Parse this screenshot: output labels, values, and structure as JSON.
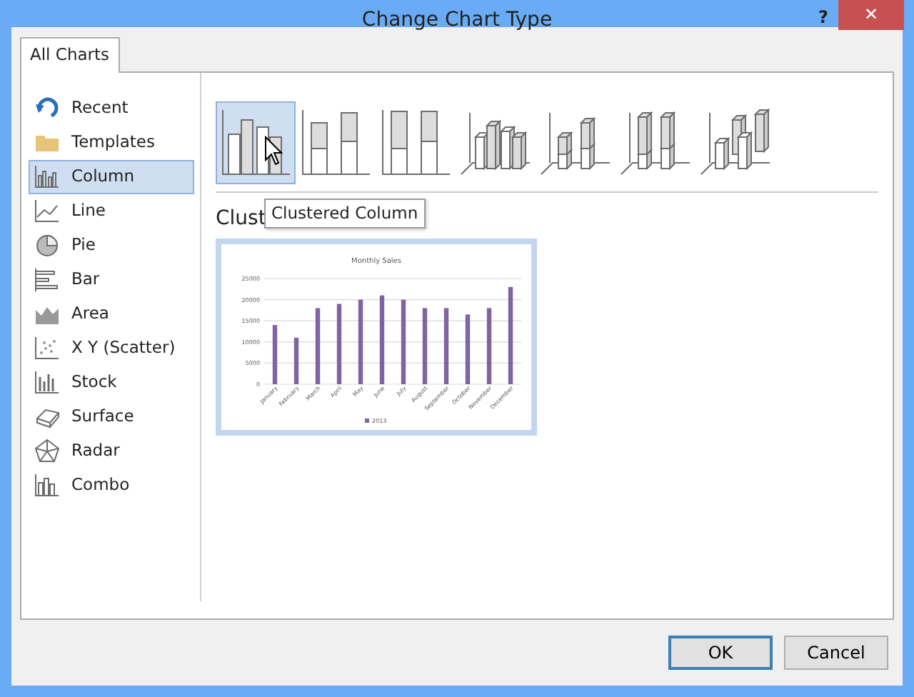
{
  "window": {
    "title": "Change Chart Type",
    "help": "?",
    "close": "✕"
  },
  "tabs": [
    {
      "label": "All Charts",
      "selected": true
    }
  ],
  "sidebar": {
    "items": [
      {
        "label": "Recent",
        "selected": false
      },
      {
        "label": "Templates",
        "selected": false
      },
      {
        "label": "Column",
        "selected": true
      },
      {
        "label": "Line",
        "selected": false
      },
      {
        "label": "Pie",
        "selected": false
      },
      {
        "label": "Bar",
        "selected": false
      },
      {
        "label": "Area",
        "selected": false
      },
      {
        "label": "X Y (Scatter)",
        "selected": false
      },
      {
        "label": "Stock",
        "selected": false
      },
      {
        "label": "Surface",
        "selected": false
      },
      {
        "label": "Radar",
        "selected": false
      },
      {
        "label": "Combo",
        "selected": false
      }
    ]
  },
  "subtypes": [
    {
      "selected": true
    },
    {
      "selected": false
    },
    {
      "selected": false
    },
    {
      "selected": false
    },
    {
      "selected": false
    },
    {
      "selected": false
    },
    {
      "selected": false
    }
  ],
  "heading": "Clust",
  "tooltip": "Clustered Column",
  "preview": {
    "chart_data": {
      "type": "bar",
      "title": "Monthly Sales",
      "categories": [
        "January",
        "February",
        "March",
        "April",
        "May",
        "June",
        "July",
        "August",
        "September",
        "October",
        "November",
        "December"
      ],
      "series": [
        {
          "name": "2013",
          "color": "#8064a2",
          "values": [
            14000,
            11000,
            18000,
            19000,
            20000,
            21000,
            20000,
            18000,
            18000,
            16500,
            18000,
            23000
          ]
        }
      ],
      "grid": true,
      "ylim": [
        0,
        25000
      ],
      "yticks": [
        0,
        5000,
        10000,
        15000,
        20000,
        25000
      ]
    }
  },
  "buttons": [
    {
      "label": "OK",
      "selected": true
    },
    {
      "label": "Cancel",
      "selected": false
    }
  ]
}
